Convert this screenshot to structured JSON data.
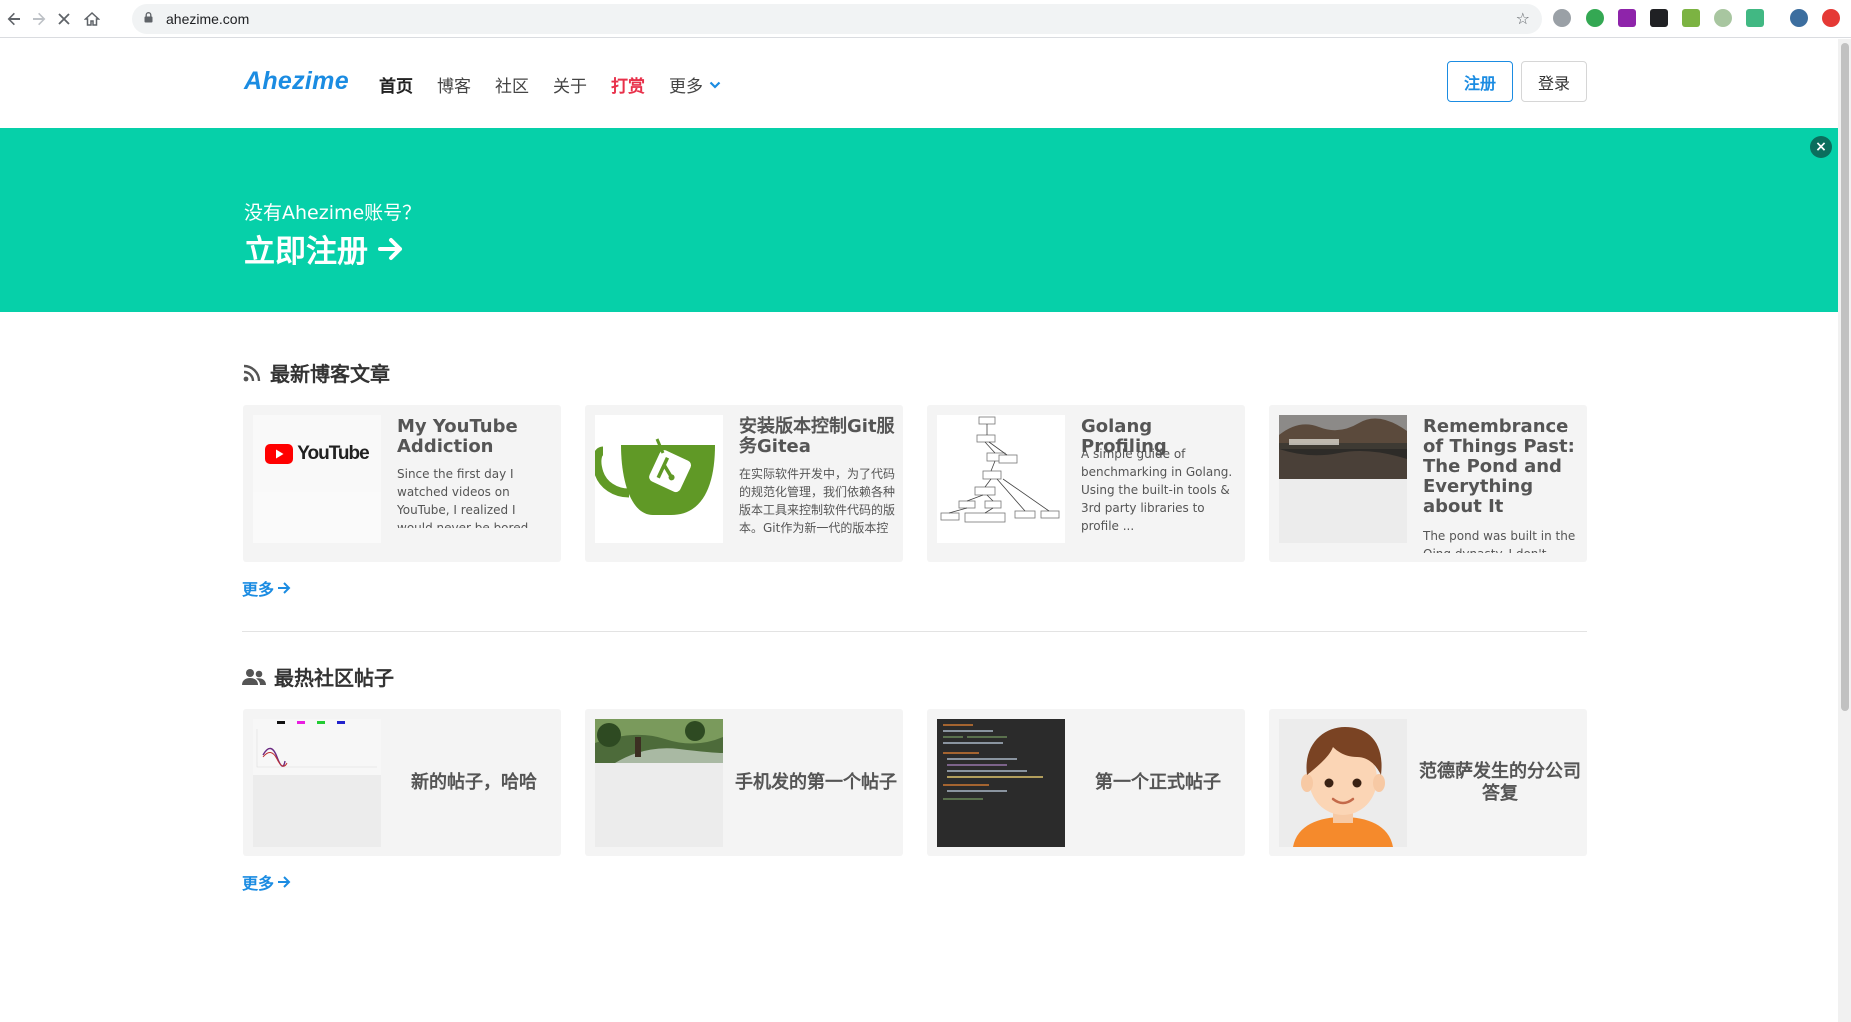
{
  "browser": {
    "url": "ahezime.com"
  },
  "header": {
    "logo": "Ahezime",
    "nav": [
      {
        "label": "首页"
      },
      {
        "label": "博客"
      },
      {
        "label": "社区"
      },
      {
        "label": "关于"
      },
      {
        "label": "打赏"
      },
      {
        "label": "更多"
      }
    ],
    "register_label": "注册",
    "login_label": "登录"
  },
  "banner": {
    "question": "没有Ahezime账号？",
    "cta": "立即注册",
    "close": "×",
    "color": "#06d0a9"
  },
  "blog": {
    "heading": "最新博客文章",
    "more": "更多",
    "cards": [
      {
        "title": "My YouTube Addiction",
        "excerpt": "Since the first day I watched videos on YouTube, I realized I would never be bored with this website...",
        "thumb_text": "YouTube"
      },
      {
        "title": "安装版本控制Git服务Gitea",
        "excerpt": "在实际软件开发中，为了代码的规范化管理，我们依赖各种版本工具来控制软件代码的版本。Git作为新一代的版本控制工具，现在已经很"
      },
      {
        "title": "Golang Profiling",
        "excerpt": "A simple guide of benchmarking in Golang. Using the built-in tools & 3rd party libraries to profile ..."
      },
      {
        "title": "Remembrance of Things Past: The Pond and Everything about It",
        "excerpt": "The pond was built in the Qing dynasty. I don't know"
      }
    ]
  },
  "community": {
    "heading": "最热社区帖子",
    "more": "更多",
    "posts": [
      {
        "title": "新的帖子，哈哈"
      },
      {
        "title": "手机发的第一个帖子"
      },
      {
        "title": "第一个正式帖子"
      },
      {
        "title": "范德萨发生的分公司答复"
      }
    ]
  },
  "colors": {
    "brand": "#1b8ce2",
    "donate": "#e8304a",
    "banner": "#06d0a9"
  }
}
